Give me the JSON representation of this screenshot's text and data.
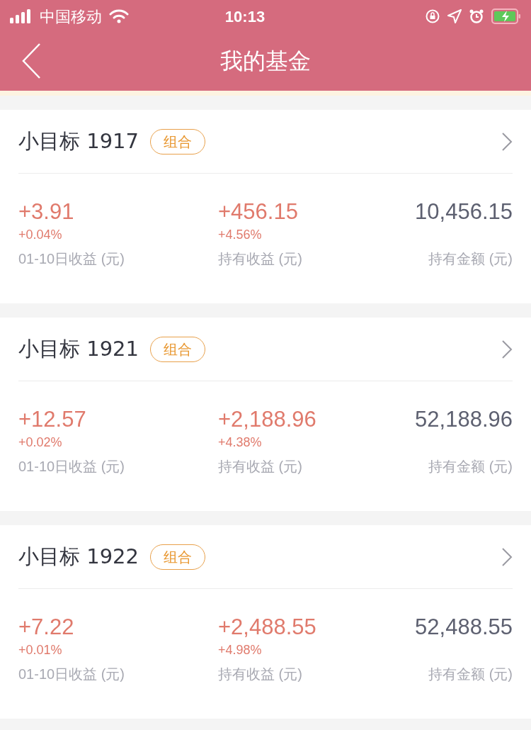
{
  "status_bar": {
    "carrier": "中国移动",
    "time": "10:13"
  },
  "header": {
    "title": "我的基金"
  },
  "funds": [
    {
      "name": "小目标 1917",
      "tag": "组合",
      "stats": [
        {
          "value": "+3.91",
          "change": "+0.04%",
          "label": "01-10日收益 (元)"
        },
        {
          "value": "+456.15",
          "change": "+4.56%",
          "label": "持有收益 (元)"
        },
        {
          "value": "10,456.15",
          "label": "持有金额 (元)"
        }
      ]
    },
    {
      "name": "小目标 1921",
      "tag": "组合",
      "stats": [
        {
          "value": "+12.57",
          "change": "+0.02%",
          "label": "01-10日收益 (元)"
        },
        {
          "value": "+2,188.96",
          "change": "+4.38%",
          "label": "持有收益 (元)"
        },
        {
          "value": "52,188.96",
          "label": "持有金额 (元)"
        }
      ]
    },
    {
      "name": "小目标 1922",
      "tag": "组合",
      "stats": [
        {
          "value": "+7.22",
          "change": "+0.01%",
          "label": "01-10日收益 (元)"
        },
        {
          "value": "+2,488.55",
          "change": "+4.98%",
          "label": "持有收益 (元)"
        },
        {
          "value": "52,488.55",
          "label": "持有金额 (元)"
        }
      ]
    }
  ]
}
